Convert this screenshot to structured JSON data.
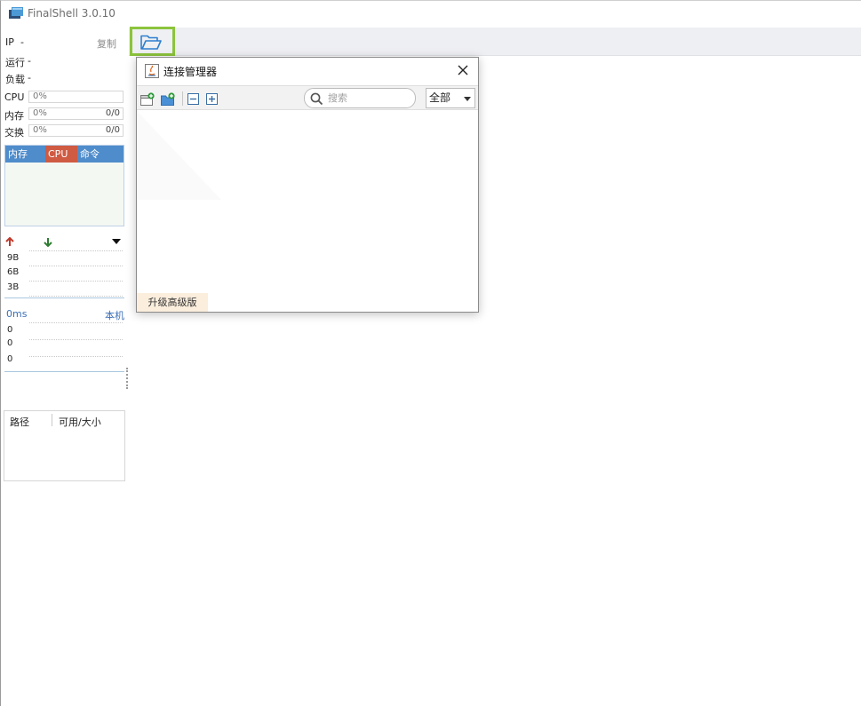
{
  "app": {
    "title": "FinalShell 3.0.10",
    "colors": {
      "accent_highlight": "#8cc43c",
      "mem_header": "#4f8ccb",
      "cpu_header": "#cf5b43",
      "upgrade_bg": "#fbeedd"
    }
  },
  "toolbar": {
    "open_icon": "folder-open-icon"
  },
  "sidebar": {
    "ip_label": "IP",
    "ip_value": "-",
    "copy_label": "复制",
    "uptime_label": "运行",
    "uptime_value": "-",
    "load_label": "负载",
    "load_value": "-",
    "cpu": {
      "label": "CPU",
      "percent": "0%"
    },
    "mem": {
      "label": "内存",
      "percent": "0%",
      "ratio": "0/0"
    },
    "swap": {
      "label": "交换",
      "percent": "0%",
      "ratio": "0/0"
    },
    "process_table": {
      "headers": [
        "内存",
        "CPU",
        "命令"
      ]
    },
    "network": {
      "ticks": [
        "9B",
        "6B",
        "3B"
      ]
    },
    "ping": {
      "latency": "0ms",
      "host": "本机",
      "ticks": [
        "0",
        "0",
        "0"
      ]
    },
    "disk_table": {
      "headers": [
        "路径",
        "可用/大小"
      ]
    }
  },
  "dialog": {
    "title": "连接管理器",
    "toolbar_icons": [
      "new-connection-icon",
      "new-folder-icon",
      "collapse-all-icon",
      "expand-all-icon"
    ],
    "search_placeholder": "搜索",
    "filter_selected": "全部",
    "upgrade_label": "升级高级版"
  }
}
